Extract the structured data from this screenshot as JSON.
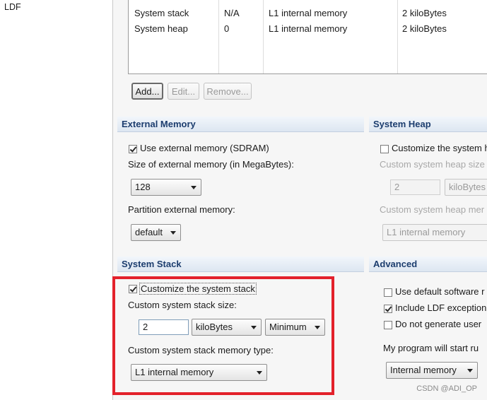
{
  "left_pane": {
    "item": "LDF"
  },
  "memory_table": {
    "rows": [
      [
        "System stack",
        "N/A",
        "L1 internal memory",
        "2 kiloBytes"
      ],
      [
        "System heap",
        "0",
        "L1 internal memory",
        "2 kiloBytes"
      ]
    ]
  },
  "table_buttons": {
    "add": "Add...",
    "edit": "Edit...",
    "remove": "Remove..."
  },
  "external_memory": {
    "header": "External Memory",
    "use_label": "Use external memory (SDRAM)",
    "use_checked": true,
    "size_label": "Size of external memory (in MegaBytes):",
    "size_value": "128",
    "partition_label": "Partition external memory:",
    "partition_value": "default"
  },
  "system_heap": {
    "header": "System Heap",
    "customize_label": "Customize the system h",
    "customize_checked": false,
    "size_label": "Custom system heap size",
    "size_value": "2",
    "unit_value": "kiloBytes",
    "type_label": "Custom system heap mer",
    "type_value": "L1 internal memory"
  },
  "system_stack": {
    "header": "System Stack",
    "customize_label": "Customize the system stack",
    "customize_checked": true,
    "size_label": "Custom system stack size:",
    "size_value": "2",
    "unit_value": "kiloBytes",
    "mode_value": "Minimum",
    "type_label": "Custom system stack memory type:",
    "type_value": "L1 internal memory"
  },
  "advanced": {
    "header": "Advanced",
    "default_software_label": "Use default software r",
    "default_software_checked": false,
    "include_ldf_label": "Include LDF exception",
    "include_ldf_checked": true,
    "no_generate_label": "Do not generate user",
    "no_generate_checked": false,
    "start_label": "My program will start ru",
    "start_value": "Internal memory"
  },
  "watermark": "CSDN @ADI_OP",
  "colors": {
    "highlight": "#e3212b",
    "section_header_text": "#1c3d6e"
  }
}
